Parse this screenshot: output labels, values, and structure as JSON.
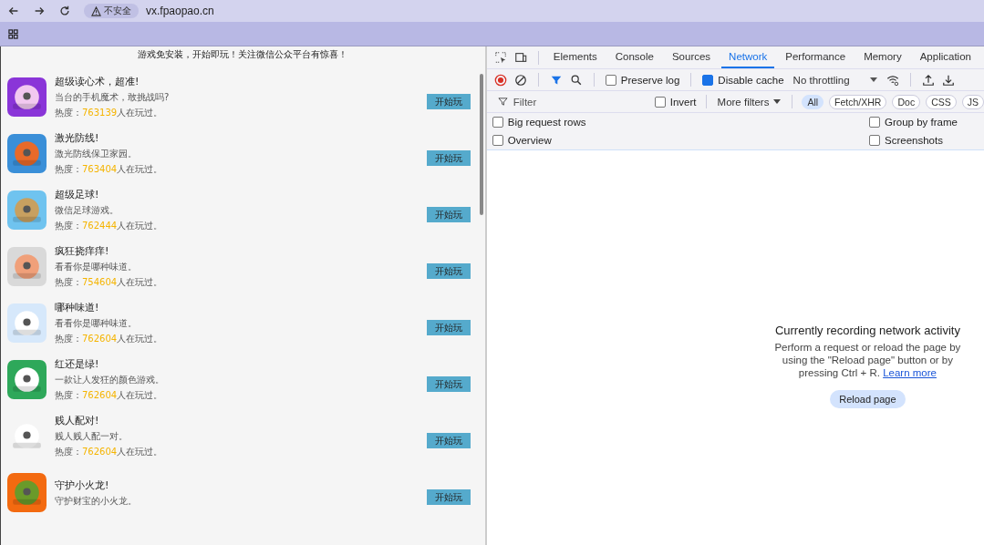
{
  "browser": {
    "security": "不安全",
    "url": "vx.fpaopao.cn"
  },
  "page": {
    "banner": "游戏免安装，开始即玩！关注微信公众平台有惊喜！",
    "games": [
      {
        "title": "超级读心术，超准!",
        "desc": "当台的手机魔术，敢挑战吗?",
        "heat_label": "热度：",
        "heat": "763139",
        "heat_suffix": "人在玩过。",
        "button": "开始玩"
      },
      {
        "title": "激光防线!",
        "desc": "激光防线保卫家园。",
        "heat_label": "热度：",
        "heat": "763404",
        "heat_suffix": "人在玩过。",
        "button": "开始玩"
      },
      {
        "title": "超级足球!",
        "desc": "微信足球游戏。",
        "heat_label": "热度：",
        "heat": "762444",
        "heat_suffix": "人在玩过。",
        "button": "开始玩"
      },
      {
        "title": "疯狂挠痒痒!",
        "desc": "看看你是哪种味道。",
        "heat_label": "热度：",
        "heat": "754604",
        "heat_suffix": "人在玩过。",
        "button": "开始玩"
      },
      {
        "title": "哪种味道!",
        "desc": "看看你是哪种味道。",
        "heat_label": "热度：",
        "heat": "762604",
        "heat_suffix": "人在玩过。",
        "button": "开始玩"
      },
      {
        "title": "红还是绿!",
        "desc": "一款让人发狂的颜色游戏。",
        "heat_label": "热度：",
        "heat": "762604",
        "heat_suffix": "人在玩过。",
        "button": "开始玩"
      },
      {
        "title": "贱人配对!",
        "desc": "贱人贱人配一对。",
        "heat_label": "热度：",
        "heat": "762604",
        "heat_suffix": "人在玩过。",
        "button": "开始玩"
      },
      {
        "title": "守护小火龙!",
        "desc": "守护财宝的小火龙。",
        "button": "开始玩"
      }
    ]
  },
  "devtools": {
    "tabs": [
      {
        "label": "Elements",
        "selected": false
      },
      {
        "label": "Console",
        "selected": false
      },
      {
        "label": "Sources",
        "selected": false
      },
      {
        "label": "Network",
        "selected": true
      },
      {
        "label": "Performance",
        "selected": false
      },
      {
        "label": "Memory",
        "selected": false
      },
      {
        "label": "Application",
        "selected": false
      }
    ],
    "preserve_log": {
      "label": "Preserve log",
      "checked": false
    },
    "disable_cache": {
      "label": "Disable cache",
      "checked": true
    },
    "throttling": "No throttling",
    "filter": {
      "placeholder": "Filter"
    },
    "invert": {
      "label": "Invert",
      "checked": false
    },
    "more_filters": "More filters",
    "type_filters": [
      {
        "label": "All",
        "selected": true
      },
      {
        "label": "Fetch/XHR",
        "selected": false
      },
      {
        "label": "Doc",
        "selected": false
      },
      {
        "label": "CSS",
        "selected": false
      },
      {
        "label": "JS",
        "selected": false
      }
    ],
    "options_left": [
      {
        "label": "Big request rows",
        "checked": false
      },
      {
        "label": "Overview",
        "checked": false
      }
    ],
    "options_right": [
      {
        "label": "Group by frame",
        "checked": false
      },
      {
        "label": "Screenshots",
        "checked": false
      }
    ],
    "empty": {
      "title": "Currently recording network activity",
      "text": "Perform a request or reload the page by using the \"Reload page\" button or by pressing Ctrl + R.",
      "link": "Learn more",
      "button": "Reload page"
    }
  }
}
